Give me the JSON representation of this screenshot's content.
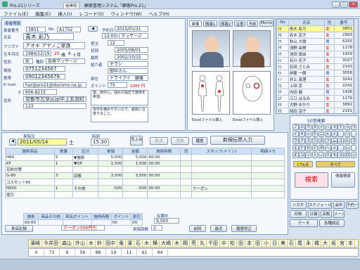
{
  "titlebar": {
    "app": "Pro.21シリーズ",
    "system": "顧客管理システム「顧客Pro.21」",
    "shop": "接骨院"
  },
  "menu": [
    "ファイル(E)",
    "編集(E)",
    "挿入(I)",
    "レコード(S)",
    "ウィンドウ(W)",
    "ヘルプ(H)"
  ],
  "customer": {
    "section_label": "患者情報",
    "no_label": "患者番号",
    "no": "3851",
    "id_label": "No",
    "id": "A1752",
    "name_label": "氏名",
    "name": "青木 彩乃",
    "kana_label": "フリガナ",
    "kana": "アオキ アヤノご家族",
    "birth_label": "生年月日",
    "birth": "1984/12/19",
    "age": "25",
    "age_unit": "歳",
    "month": "6",
    "month_unit": "ヶ月",
    "sex_label": "性別",
    "sex": "女",
    "course_label": "種別",
    "course": "自費マッサージ",
    "tel_label": "電話",
    "tel": "0751234567",
    "mobile_label": "携帯",
    "mobile": "09012345678",
    "mail_label": "E-mail",
    "mail": "har@pro21@docomo.ne.jp",
    "zip_label": "〒",
    "zip": "606-8215",
    "addr_label": "住所",
    "addr1": "京都市左京区田中上玄京町",
    "addr2": "123",
    "visit_label": "予約日",
    "visit": "2015/01/31",
    "time": "12:00",
    "menu_name": "マッサージ",
    "staff_label": "担当",
    "staff": "12",
    "first_label": "初回",
    "first": "2005/08/01",
    "last_label": "最終",
    "last": "2002/10/15",
    "ref_label": "紹介者",
    "ref": "チラシ",
    "ref2": "田中さん",
    "part_label": "部位",
    "part": "ドライアイ　腰痛",
    "point_label": "ポイント",
    "point": "75",
    "point_value": "1000 円",
    "memo": "首、肩中心。強めの指圧で施術を希望。",
    "memo2": "背中を痛めやすいので、姿勢に注意すること。"
  },
  "tabs": [
    "画像",
    "情報1",
    "情報2",
    "注意",
    "予約",
    "Memo"
  ],
  "photo_captions": [
    "Excelファイル挿入",
    "Excelファイル挿入"
  ],
  "list": {
    "headers": [
      "No",
      "氏名",
      "性",
      "番号"
    ],
    "rows": [
      [
        "ｱｵ",
        "青木 彩乃",
        "女",
        "3851"
      ],
      [
        "ｱｶ",
        "赤木 京子",
        "女",
        "2993"
      ],
      [
        "ｱｷ",
        "秋山 大樹",
        "男",
        "6155"
      ],
      [
        "ｱｻ",
        "浅野 由美",
        "女",
        "1178"
      ],
      [
        "ｲｹ",
        "池田 真由",
        "女",
        "1929"
      ],
      [
        "ｲｼ",
        "石川 花子",
        "女",
        "3027"
      ],
      [
        "ｲｼ",
        "石田 さとみ",
        "女",
        "2143"
      ],
      [
        "ｲﾄ",
        "伊藤 一朗",
        "男",
        "3058"
      ],
      [
        "ｲﾉ",
        "井上 真理",
        "女",
        "3241"
      ],
      [
        "ｳｴ",
        "上田 京",
        "女",
        "2241"
      ],
      [
        "ｳﾁ",
        "内田 健",
        "男",
        "1436"
      ],
      [
        "ｴｸ",
        "江口 はるみ",
        "女",
        "1179"
      ],
      [
        "ｵｵ",
        "大野 ゆかり",
        "女",
        "3891"
      ],
      [
        "ｵｶ",
        "岡田 淳子",
        "女",
        "2191"
      ],
      [
        "ｵｶ",
        "岡本 沙織",
        "女",
        "5173"
      ],
      [
        "ｵｶ",
        "岡村 正",
        "男",
        "1178"
      ],
      [
        "ｵｻ",
        "小沢 理恵",
        "女",
        "3892"
      ],
      [
        "ｶﾄ",
        "加藤 美香",
        "女",
        "2381"
      ]
    ]
  },
  "sales": {
    "date_label": "来院日",
    "date": "2011/05/14",
    "day": "土",
    "time_label": "時刻",
    "time": "15:30",
    "cancel": "取消",
    "register": "登録",
    "history": "履歴",
    "new_sale": "新規伝票入力",
    "sales_total_label": "売上合計",
    "headers": [
      "施術商品",
      "数量",
      "区分",
      "単価",
      "金額",
      "施術時間",
      "消",
      "スタッフ(メイン)",
      "明細メモ"
    ],
    "rows": [
      [
        "H60",
        "5",
        "▼施術",
        "5,000",
        "5,000",
        "60:00",
        "",
        "",
        ""
      ],
      [
        "KF",
        "1",
        "▼OP",
        "1,500",
        "1,500",
        "00:00",
        "",
        "",
        ""
      ],
      [
        "花粉対策",
        "",
        "",
        "",
        "",
        "",
        "",
        "",
        ""
      ],
      [
        "G-80",
        "3",
        "店販",
        "3,500",
        "3,500",
        "00:00",
        "",
        "",
        ""
      ],
      [
        "コルセット80",
        "",
        "",
        "",
        "",
        "",
        "",
        "",
        ""
      ],
      [
        "N500",
        "1",
        "その他",
        "-500",
        "-500",
        "00:00",
        "",
        "クーポン",
        ""
      ],
      [
        "値引",
        "",
        "",
        "",
        "",
        "",
        "",
        "",
        ""
      ]
    ],
    "foot_labels": [
      "施術",
      "商品その他",
      "来店ポイント",
      "施術時間",
      "ポイント",
      "割引"
    ],
    "foot_values": [
      "00:00",
      "",
      "",
      "",
      "00",
      "00"
    ],
    "coupon": "クーポン500円引",
    "new_visit": "来店記録",
    "total_label": "伝票計",
    "total": "9,000",
    "prev": "前回",
    "latest": "最近",
    "history_fix": "履歴修正",
    "visit_count_label": "来院回数",
    "visit_count": "2"
  },
  "kana_keys": [
    "ア",
    "カ",
    "サ",
    "タ",
    "ナ",
    "ハ",
    "マ",
    "ヤ",
    "ラ",
    "ワ",
    "イ",
    "キ",
    "シ",
    "チ",
    "ニ",
    "ヒ",
    "ミ",
    "",
    "リ",
    "",
    "ウ",
    "ク",
    "ス",
    "ツ",
    "ヌ",
    "フ",
    "ム",
    "ユ",
    "ル",
    "ヲ",
    "エ",
    "ケ",
    "セ",
    "テ",
    "ネ",
    "ヘ",
    "メ",
    "",
    "レ",
    "",
    "オ",
    "コ",
    "ソ",
    "ト",
    "ノ",
    "ホ",
    "モ",
    "ヨ",
    "ロ",
    "ン"
  ],
  "kana_panel": {
    "header": "50音検索",
    "clear": "CT&名",
    "all": "すべて",
    "search": "検索",
    "search_label": "検索",
    "sub": "情報検索",
    "side_btn": "全般"
  },
  "right_buttons": [
    "ハガキ",
    "スケジュール",
    "会計",
    "予約一覧",
    "印刷",
    "日報",
    "店販",
    "メール",
    "データ",
    "各種設定"
  ],
  "bottom_names": [
    "濱崎",
    "今井田",
    "森山",
    "外山",
    "木",
    "鈴",
    "田中",
    "竜",
    "濱",
    "石",
    "木",
    "横",
    "大嶋",
    "木",
    "桐",
    "荒",
    "丸",
    "千田",
    "中",
    "松",
    "田",
    "本",
    "田",
    "小",
    "日",
    "美",
    "石",
    "尾",
    "永",
    "梶",
    "大",
    "坂",
    "宮",
    "本"
  ],
  "bottom_nums": [
    "0",
    "73",
    "6",
    "56",
    "88",
    "19",
    "11",
    "61",
    "94"
  ],
  "colors": {
    "accent": "#1c3f7a",
    "hi": "#ffff99",
    "red": "#cc0000",
    "panel": "#f4f7fb"
  }
}
